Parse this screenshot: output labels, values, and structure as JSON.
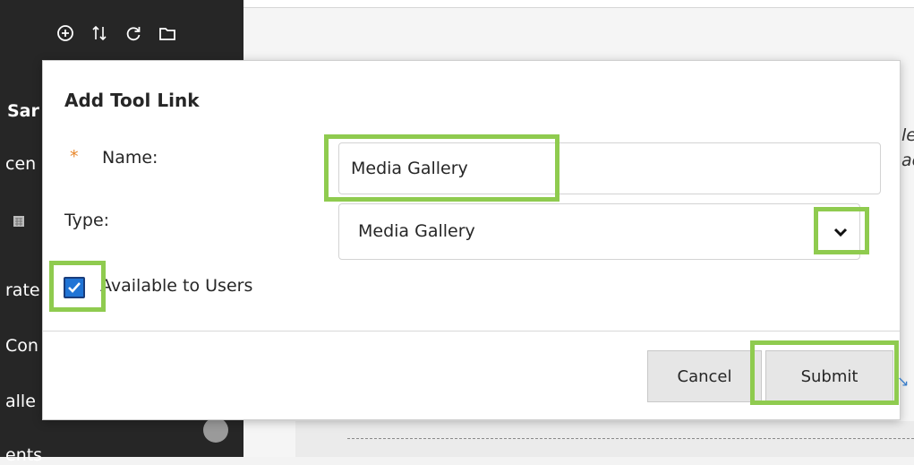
{
  "sidebar": {
    "text_fragments": [
      "Sar",
      "cen",
      "rate",
      "Con",
      "alle",
      "ents"
    ]
  },
  "background": {
    "edge_text_1": "le",
    "edge_text_2": "ac"
  },
  "modal": {
    "title": "Add Tool Link",
    "name_label": "Name:",
    "name_value": "Media Gallery",
    "required_marker": "*",
    "type_label": "Type:",
    "type_value": "Media Gallery",
    "available_label": "Available to Users",
    "available_checked": true,
    "cancel_label": "Cancel",
    "submit_label": "Submit"
  },
  "colors": {
    "highlight": "#8fcb4f",
    "checkbox": "#2074d5",
    "required": "#e8872b",
    "sidebar": "#262626"
  },
  "icons": [
    "plus-circle-icon",
    "sort-arrows-icon",
    "refresh-icon",
    "folder-icon",
    "calendar-icon",
    "chevron-down-icon",
    "checkmark-icon"
  ]
}
